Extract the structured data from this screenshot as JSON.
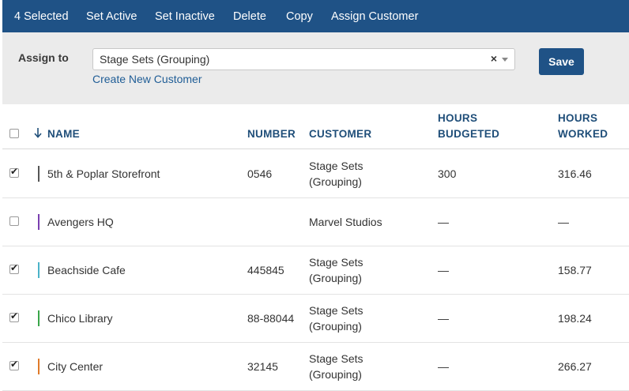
{
  "toolbar": {
    "selected_label": "4 Selected",
    "set_active": "Set Active",
    "set_inactive": "Set Inactive",
    "delete": "Delete",
    "copy": "Copy",
    "assign_customer": "Assign Customer"
  },
  "assign": {
    "label": "Assign to",
    "selected_value": "Stage Sets (Grouping)",
    "clear_glyph": "×",
    "create_link": "Create New Customer",
    "save_label": "Save"
  },
  "table": {
    "headers": {
      "name": "NAME",
      "number": "NUMBER",
      "customer": "CUSTOMER",
      "hours_budgeted_line1": "HOURS",
      "hours_budgeted_line2": "BUDGETED",
      "hours_worked_line1": "HOURS",
      "hours_worked_line2": "WORKED"
    },
    "rows": [
      {
        "checked": true,
        "color": "#555555",
        "name": "5th & Poplar Storefront",
        "number": "0546",
        "customer_line1": "Stage Sets",
        "customer_line2": "(Grouping)",
        "budgeted": "300",
        "worked": "316.46"
      },
      {
        "checked": false,
        "color": "#7a3fb0",
        "name": "Avengers HQ",
        "number": "",
        "customer_line1": "Marvel Studios",
        "customer_line2": "",
        "budgeted": "—",
        "worked": "—"
      },
      {
        "checked": true,
        "color": "#4bb3c8",
        "name": "Beachside Cafe",
        "number": "445845",
        "customer_line1": "Stage Sets",
        "customer_line2": "(Grouping)",
        "budgeted": "—",
        "worked": "158.77"
      },
      {
        "checked": true,
        "color": "#3aa64a",
        "name": "Chico Library",
        "number": "88-88044",
        "customer_line1": "Stage Sets",
        "customer_line2": "(Grouping)",
        "budgeted": "—",
        "worked": "198.24"
      },
      {
        "checked": true,
        "color": "#e07b2a",
        "name": "City Center",
        "number": "32145",
        "customer_line1": "Stage Sets",
        "customer_line2": "(Grouping)",
        "budgeted": "—",
        "worked": "266.27"
      }
    ]
  },
  "colors": {
    "toolbar_bg": "#1f5286",
    "header_text": "#1f4e79",
    "link": "#1f5d96"
  }
}
